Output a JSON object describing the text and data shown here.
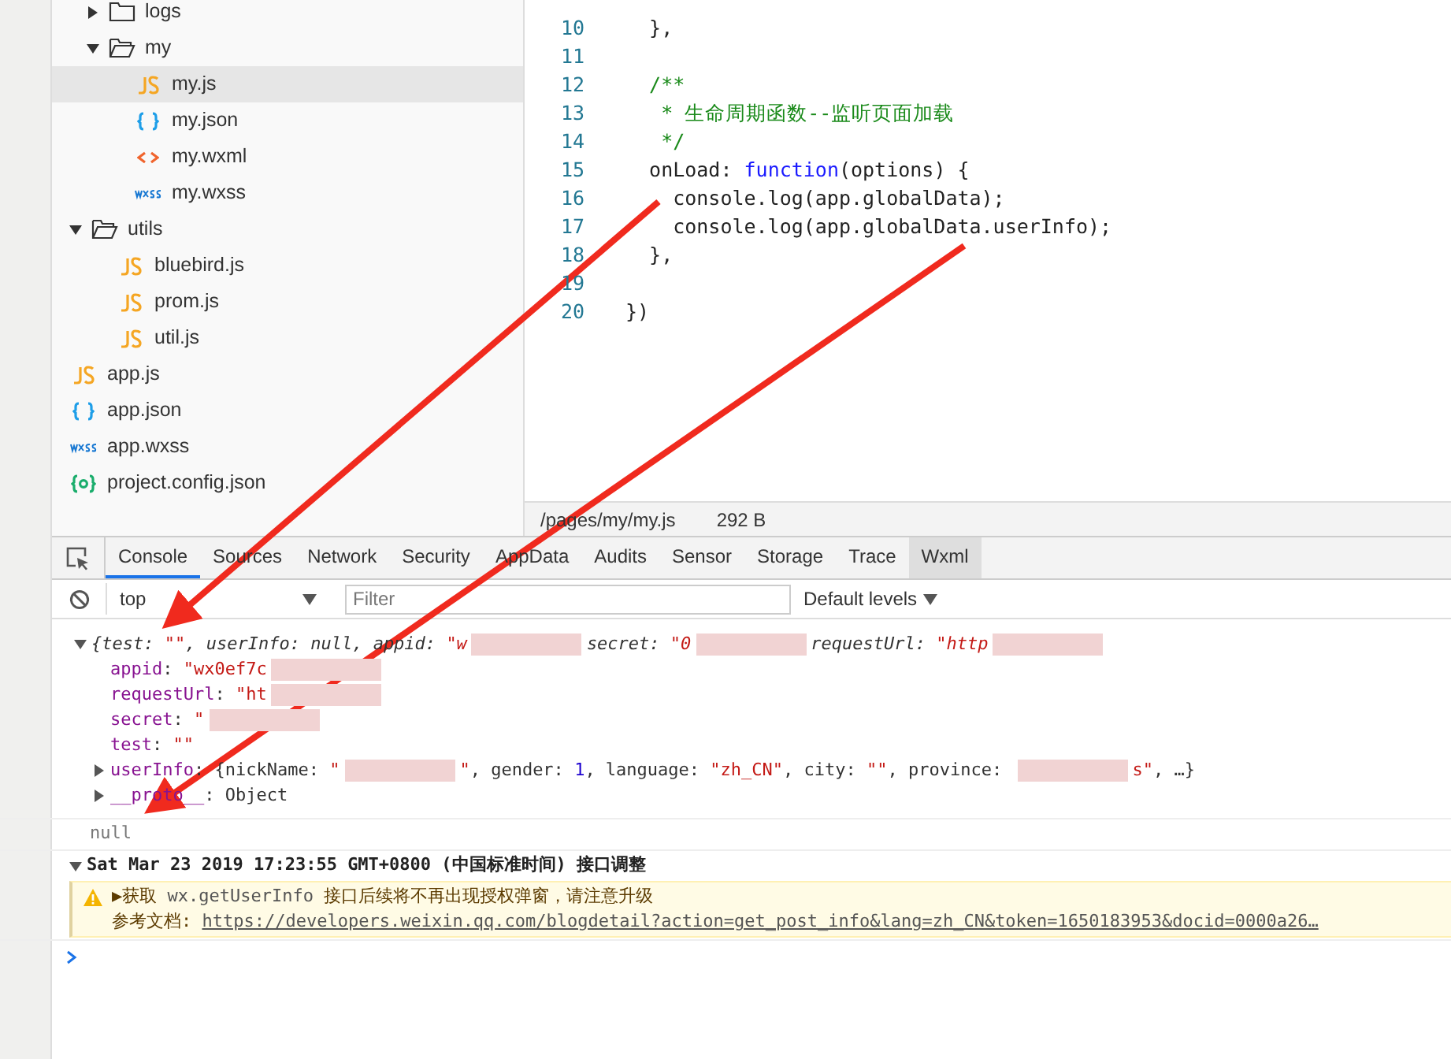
{
  "file_tree": {
    "nested_items": [
      {
        "name": "logs",
        "kind": "folder",
        "expanded": false,
        "selected": false
      },
      {
        "name": "my",
        "kind": "folder",
        "expanded": true,
        "selected": false,
        "children": [
          {
            "name": "my.js",
            "kind": "js",
            "selected": true
          },
          {
            "name": "my.json",
            "kind": "json",
            "selected": false
          },
          {
            "name": "my.wxml",
            "kind": "wxml",
            "selected": false
          },
          {
            "name": "my.wxss",
            "kind": "wxss",
            "selected": false
          }
        ]
      }
    ],
    "items": [
      {
        "name": "utils",
        "kind": "folder",
        "expanded": true,
        "selected": false,
        "children": [
          {
            "name": "bluebird.js",
            "kind": "js",
            "selected": false
          },
          {
            "name": "prom.js",
            "kind": "js",
            "selected": false
          },
          {
            "name": "util.js",
            "kind": "js",
            "selected": false
          }
        ]
      },
      {
        "name": "app.js",
        "kind": "js",
        "selected": false
      },
      {
        "name": "app.json",
        "kind": "json",
        "selected": false
      },
      {
        "name": "app.wxss",
        "kind": "wxss",
        "selected": false
      },
      {
        "name": "project.config.json",
        "kind": "config",
        "selected": false
      }
    ]
  },
  "editor": {
    "lines": [
      {
        "number": "10",
        "tokens": [
          {
            "t": "  },",
            "kind": "plain"
          }
        ]
      },
      {
        "number": "11"
      },
      {
        "number": "12",
        "tokens": [
          {
            "t": "  /**",
            "kind": "comment"
          }
        ]
      },
      {
        "number": "13",
        "tokens": [
          {
            "t": "   * 生命周期函数--监听页面加载",
            "kind": "comment"
          }
        ]
      },
      {
        "number": "14",
        "tokens": [
          {
            "t": "   */",
            "kind": "comment"
          }
        ]
      },
      {
        "number": "15",
        "tokens": [
          {
            "t": "  onLoad: ",
            "kind": "plain"
          },
          {
            "t": "function",
            "kind": "keyword"
          },
          {
            "t": "(options) {",
            "kind": "plain"
          }
        ]
      },
      {
        "number": "16",
        "tokens": [
          {
            "t": "    console.log(app.globalData);",
            "kind": "plain"
          }
        ]
      },
      {
        "number": "17",
        "tokens": [
          {
            "t": "    console.log(app.globalData.userInfo);",
            "kind": "plain"
          }
        ]
      },
      {
        "number": "18",
        "tokens": [
          {
            "t": "  },",
            "kind": "plain"
          }
        ]
      },
      {
        "number": "19"
      },
      {
        "number": "20",
        "tokens": [
          {
            "t": "})",
            "kind": "plain"
          }
        ]
      }
    ],
    "status": {
      "path": "/pages/my/my.js",
      "size": "292 B"
    }
  },
  "devtools": {
    "tabs": [
      {
        "label": "Console",
        "selected": true,
        "highlighted": false
      },
      {
        "label": "Sources",
        "selected": false,
        "highlighted": false
      },
      {
        "label": "Network",
        "selected": false,
        "highlighted": false
      },
      {
        "label": "Security",
        "selected": false,
        "highlighted": false
      },
      {
        "label": "AppData",
        "selected": false,
        "highlighted": false
      },
      {
        "label": "Audits",
        "selected": false,
        "highlighted": false
      },
      {
        "label": "Sensor",
        "selected": false,
        "highlighted": false
      },
      {
        "label": "Storage",
        "selected": false,
        "highlighted": false
      },
      {
        "label": "Trace",
        "selected": false,
        "highlighted": false
      },
      {
        "label": "Wxml",
        "selected": false,
        "highlighted": true
      }
    ],
    "context": "top",
    "filter": {
      "placeholder": "Filter"
    },
    "levels": "Default levels"
  },
  "console": [
    {
      "kind": "object",
      "expanded": true,
      "tokens": [
        {
          "t": "{test: ",
          "kind": "plain"
        },
        {
          "t": "\"\"",
          "kind": "string"
        },
        {
          "t": ", userInfo: null, appid: ",
          "kind": "plain"
        },
        {
          "t": "\"w",
          "kind": "string"
        },
        {
          "kind": "redacted"
        },
        {
          "t": "secret: ",
          "kind": "plain"
        },
        {
          "t": "\"0",
          "kind": "string"
        },
        {
          "kind": "redacted"
        },
        {
          "t": "requestUrl: ",
          "kind": "plain"
        },
        {
          "t": "\"http",
          "kind": "string"
        },
        {
          "kind": "redacted"
        }
      ]
    },
    {
      "kind": "property",
      "tokens": [
        {
          "t": "appid",
          "kind": "key"
        },
        {
          "t": ": ",
          "kind": "plain"
        },
        {
          "t": "\"wx0ef7c",
          "kind": "string"
        },
        {
          "kind": "redacted"
        }
      ]
    },
    {
      "kind": "property",
      "tokens": [
        {
          "t": "requestUrl",
          "kind": "key"
        },
        {
          "t": ": ",
          "kind": "plain"
        },
        {
          "t": "\"ht",
          "kind": "string"
        },
        {
          "kind": "redacted"
        }
      ]
    },
    {
      "kind": "property",
      "tokens": [
        {
          "t": "secret",
          "kind": "key"
        },
        {
          "t": ": ",
          "kind": "plain"
        },
        {
          "t": "\"",
          "kind": "string"
        },
        {
          "kind": "redacted"
        }
      ]
    },
    {
      "kind": "property",
      "tokens": [
        {
          "t": "test",
          "kind": "key"
        },
        {
          "t": ": ",
          "kind": "plain"
        },
        {
          "t": "\"\"",
          "kind": "string"
        }
      ]
    },
    {
      "kind": "property",
      "expanded": false,
      "tokens": [
        {
          "t": "userInfo",
          "kind": "key"
        },
        {
          "t": ": {nickName: ",
          "kind": "plain"
        },
        {
          "t": "\"",
          "kind": "string"
        },
        {
          "kind": "redacted"
        },
        {
          "t": "\"",
          "kind": "string"
        },
        {
          "t": ", gender: ",
          "kind": "plain"
        },
        {
          "t": "1",
          "kind": "number"
        },
        {
          "t": ", language: ",
          "kind": "plain"
        },
        {
          "t": "\"zh_CN\"",
          "kind": "string"
        },
        {
          "t": ", city: ",
          "kind": "plain"
        },
        {
          "t": "\"\"",
          "kind": "string"
        },
        {
          "t": ", province: ",
          "kind": "plain"
        },
        {
          "kind": "redacted"
        },
        {
          "t": "s\"",
          "kind": "string"
        },
        {
          "t": ", …}",
          "kind": "plain"
        }
      ]
    },
    {
      "kind": "property",
      "expanded": false,
      "tokens": [
        {
          "t": "__proto__",
          "kind": "key"
        },
        {
          "t": ": Object",
          "kind": "plain"
        }
      ]
    },
    {
      "kind": "null",
      "tokens": [
        {
          "t": "null",
          "kind": "plain"
        }
      ]
    },
    {
      "kind": "group",
      "expanded": true,
      "tokens": [
        {
          "t": "Sat Mar 23 2019 17:23:55 GMT+0800 (中国标准时间) 接口调整",
          "kind": "plain"
        }
      ]
    },
    {
      "kind": "warning",
      "tokens": [
        {
          "t": "▶获取 ",
          "kind": "plain"
        },
        {
          "t": "wx.getUserInfo",
          "kind": "code"
        },
        {
          "t": " 接口后续将不再出现授权弹窗，请注意升级",
          "kind": "plain"
        }
      ],
      "reference": {
        "label": "参考文档: ",
        "link": "https://developers.weixin.qq.com/blogdetail?action=get_post_info&lang=zh_CN&token=1650183953&docid=0000a26…"
      }
    }
  ]
}
